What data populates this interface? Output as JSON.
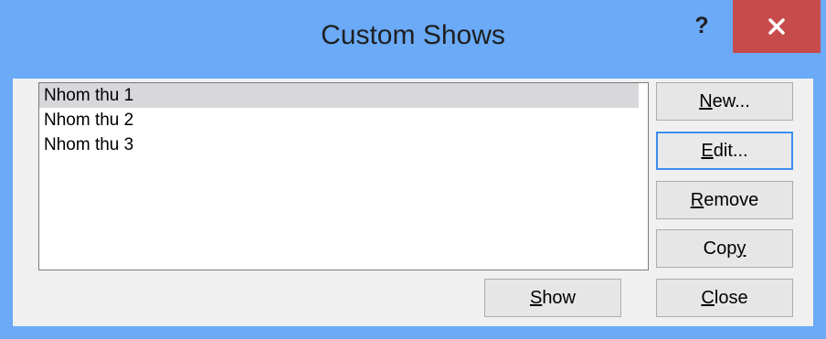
{
  "dialog": {
    "title": "Custom Shows",
    "help_glyph": "?",
    "close_glyph": "✕"
  },
  "shows": {
    "items": [
      "Nhom thu 1",
      "Nhom thu 2",
      "Nhom thu 3"
    ],
    "selected_index": 0
  },
  "buttons": {
    "new": {
      "label": "New...",
      "mnemonic": "N"
    },
    "edit": {
      "label": "Edit...",
      "mnemonic": "E"
    },
    "remove": {
      "label": "Remove",
      "mnemonic": "R"
    },
    "copy": {
      "label": "Copy",
      "mnemonic": "y"
    },
    "show": {
      "label": "Show",
      "mnemonic": "S"
    },
    "close": {
      "label": "Close",
      "mnemonic": "C"
    }
  },
  "colors": {
    "titlebar": "#6aaaf7",
    "close_button": "#c74b4b",
    "default_button_border": "#3c8ef0",
    "selection": "#d8d8dc"
  }
}
